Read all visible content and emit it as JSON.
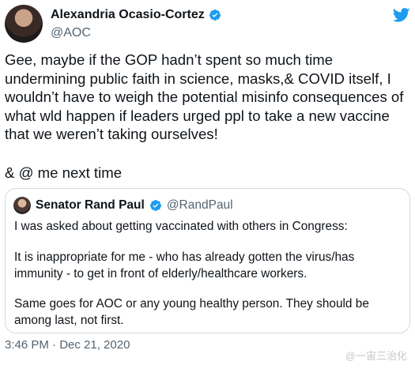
{
  "tweet": {
    "author_name": "Alexandria Ocasio-Cortez",
    "author_handle": "@AOC",
    "text_main": "Gee, maybe if the GOP hadn’t spent so much time undermining public faith in science, masks,& COVID itself, I wouldn’t have to weigh the potential misinfo consequences of what wld happen if leaders urged ppl to take a new vaccine that we weren’t taking ourselves!",
    "text_secondary": "& @ me next time",
    "timestamp": "3:46 PM · Dec 21, 2020"
  },
  "quoted_tweet": {
    "author_name": "Senator Rand Paul",
    "author_handle": "@RandPaul",
    "paragraphs": [
      "I was asked about getting vaccinated with others in Congress:",
      "It is inappropriate for me - who has already gotten the virus/has immunity - to get in front of elderly/healthcare workers.",
      "Same goes for AOC or any young healthy person. They should be among last, not first."
    ]
  },
  "watermark": "@一宙三治化",
  "icons": [
    "verified-badge-icon",
    "twitter-bird-icon"
  ],
  "colors": {
    "verified": "#1d9bf0",
    "twitter": "#1d9bf0",
    "secondary_text": "#536471"
  }
}
